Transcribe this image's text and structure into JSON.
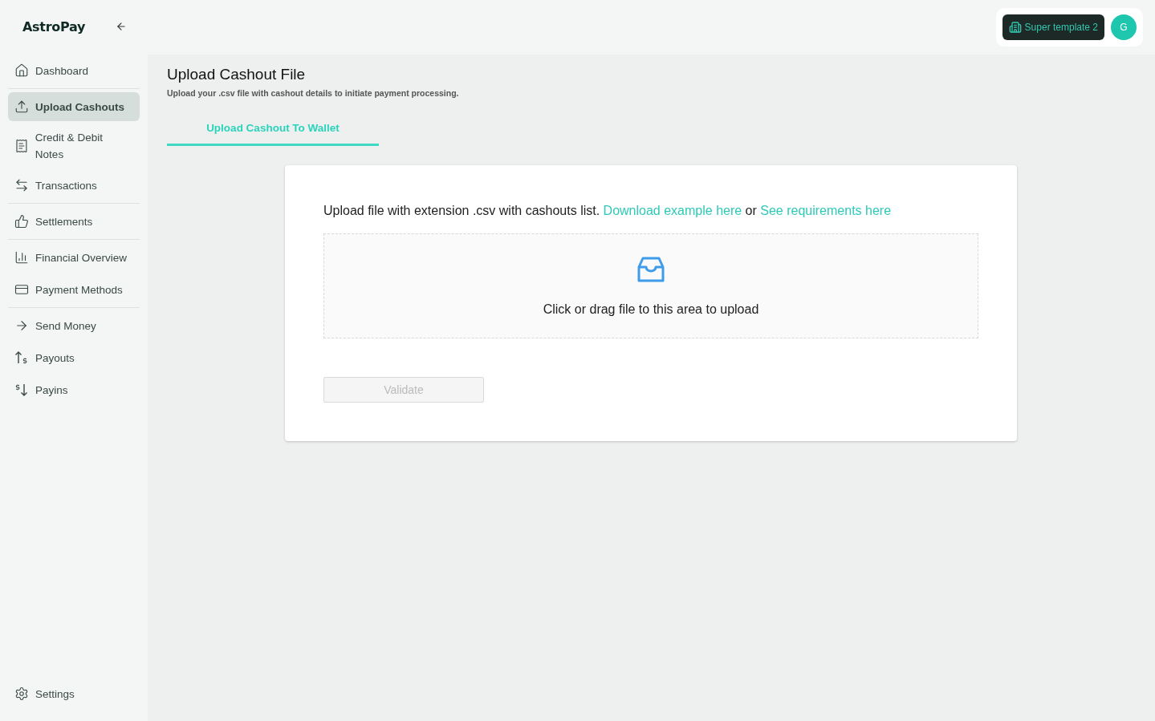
{
  "brand": "AstroPay",
  "sidebar": {
    "groups": [
      [
        {
          "label": "Dashboard",
          "selected": false
        }
      ],
      [
        {
          "label": "Upload Cashouts",
          "selected": true
        },
        {
          "label": "Credit & Debit Notes",
          "selected": false
        },
        {
          "label": "Transactions",
          "selected": false
        }
      ],
      [
        {
          "label": "Settlements",
          "selected": false
        }
      ],
      [
        {
          "label": "Financial Overview",
          "selected": false
        },
        {
          "label": "Payment Methods",
          "selected": false
        }
      ],
      [
        {
          "label": "Send Money",
          "selected": false
        },
        {
          "label": "Payouts",
          "selected": false
        },
        {
          "label": "Payins",
          "selected": false
        }
      ]
    ],
    "footer": {
      "label": "Settings"
    }
  },
  "header": {
    "workspace": "Super template 2",
    "avatar": "G"
  },
  "page": {
    "title": "Upload Cashout File",
    "subtitle": "Upload your .csv file with cashout details to initiate payment processing."
  },
  "tabs": [
    {
      "label": "Upload Cashout To Wallet",
      "selected": true
    }
  ],
  "card": {
    "intro": "Upload file with extension .csv with cashouts list.",
    "links": [
      "Download example here",
      "See requirements here"
    ],
    "joiner": "or",
    "dropzone": "Click or drag file to this area to upload",
    "button": {
      "label": "Validate",
      "disabled": true
    }
  }
}
